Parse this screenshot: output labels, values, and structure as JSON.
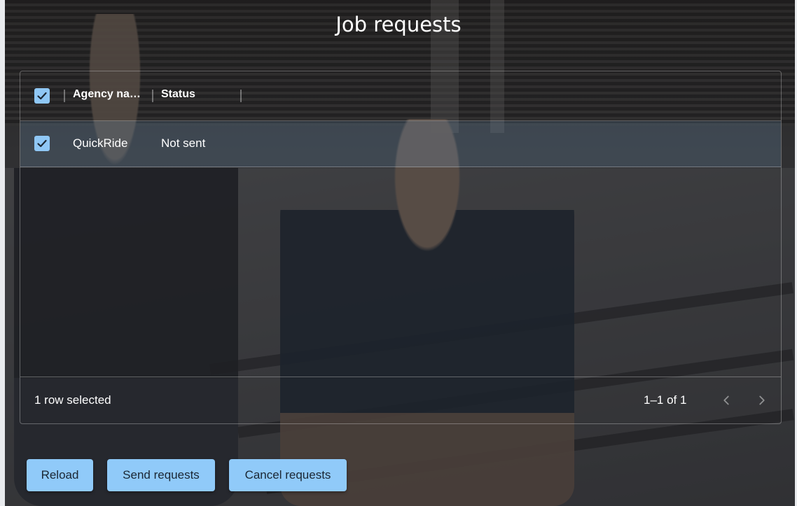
{
  "page": {
    "title": "Job requests"
  },
  "grid": {
    "header": {
      "columns": [
        {
          "label": "Agency name"
        },
        {
          "label": "Status"
        }
      ],
      "select_all_checked": true
    },
    "rows": [
      {
        "agency": "QuickRide",
        "status": "Not sent",
        "checked": true
      }
    ],
    "footer": {
      "selected_text": "1 row selected",
      "pagination": "1–1 of 1",
      "prev_icon": "chevron-left-icon",
      "next_icon": "chevron-right-icon"
    }
  },
  "actions": {
    "reload": "Reload",
    "send": "Send requests",
    "cancel": "Cancel requests"
  },
  "colors": {
    "accent": "#90caf9",
    "button_text": "#1b2733"
  }
}
